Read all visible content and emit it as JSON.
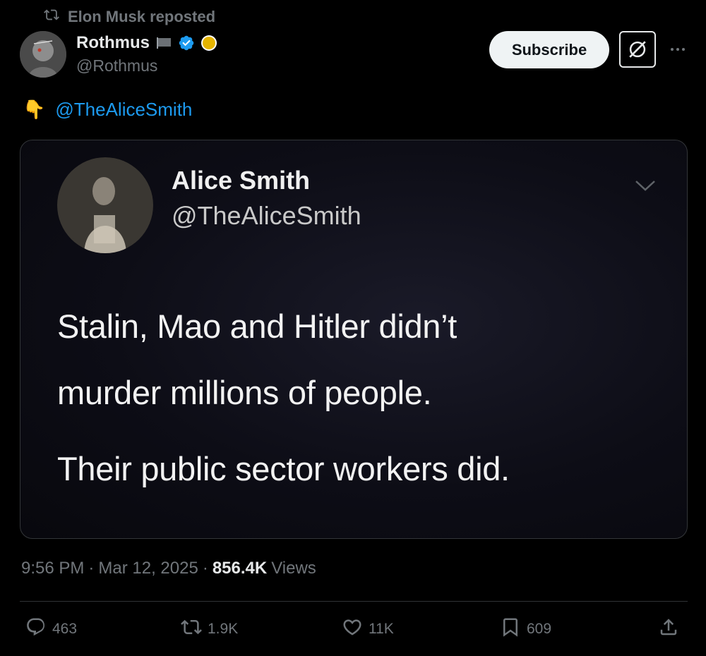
{
  "repost": {
    "text": "Elon Musk reposted",
    "icon": "repost-icon"
  },
  "author": {
    "name": "Rothmus",
    "handle": "@Rothmus",
    "badges": [
      "flag-icon",
      "verified-badge-icon",
      "gold-circle-icon"
    ]
  },
  "header_actions": {
    "subscribe_label": "Subscribe",
    "grok_icon": "grok-icon",
    "more_icon": "more-icon"
  },
  "tweet": {
    "emoji": "👇",
    "mention": "@TheAliceSmith"
  },
  "media": {
    "name": "Alice Smith",
    "handle": "@TheAliceSmith",
    "line1": "Stalin, Mao and Hitler didn’t",
    "line2": "murder millions of people.",
    "line3": "Their public sector workers did."
  },
  "meta": {
    "time": "9:56 PM",
    "sep1": "·",
    "date": "Mar 12, 2025",
    "sep2": "·",
    "views_count": "856.4K",
    "views_label": "Views"
  },
  "actions": {
    "replies": "463",
    "reposts": "1.9K",
    "likes": "11K",
    "bookmarks": "609"
  },
  "colors": {
    "accent": "#1d9bf0",
    "background": "#000000",
    "muted": "#71767b",
    "text": "#e7e9ea"
  }
}
